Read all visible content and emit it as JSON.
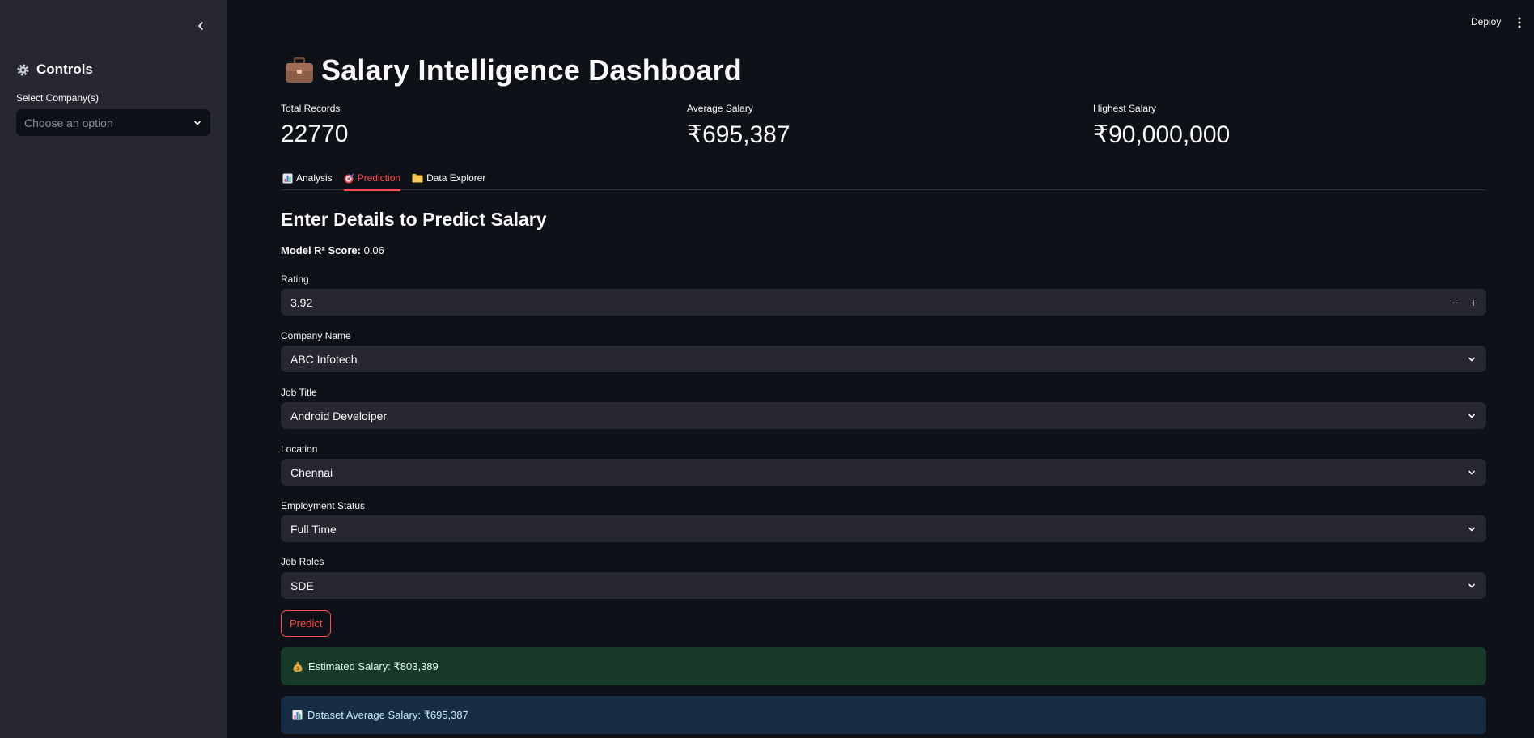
{
  "sidebar": {
    "title": "Controls",
    "title_icon": "gear-icon",
    "select_label": "Select Company(s)",
    "select_placeholder": "Choose an option"
  },
  "topbar": {
    "deploy_label": "Deploy"
  },
  "header": {
    "title": "Salary Intelligence Dashboard",
    "title_icon": "briefcase-icon"
  },
  "metrics": [
    {
      "label": "Total Records",
      "value": "22770"
    },
    {
      "label": "Average Salary",
      "value": "₹695,387"
    },
    {
      "label": "Highest Salary",
      "value": "₹90,000,000"
    }
  ],
  "tabs": [
    {
      "label": "Analysis",
      "icon": "bar-chart-icon",
      "active": false
    },
    {
      "label": "Prediction",
      "icon": "target-icon",
      "active": true
    },
    {
      "label": "Data Explorer",
      "icon": "folder-icon",
      "active": false
    }
  ],
  "prediction": {
    "section_title": "Enter Details to Predict Salary",
    "r2_label": "Model R² Score:",
    "r2_value": "0.06",
    "fields": [
      {
        "label": "Rating",
        "value": "3.92",
        "kind": "number"
      },
      {
        "label": "Company Name",
        "value": "ABC Infotech",
        "kind": "select"
      },
      {
        "label": "Job Title",
        "value": "Android Develoiper",
        "kind": "select"
      },
      {
        "label": "Location",
        "value": "Chennai",
        "kind": "select"
      },
      {
        "label": "Employment Status",
        "value": "Full Time",
        "kind": "select"
      },
      {
        "label": "Job Roles",
        "value": "SDE",
        "kind": "select"
      }
    ],
    "stepper_minus": "−",
    "stepper_plus": "+",
    "predict_label": "Predict",
    "result_success": "Estimated Salary: ₹803,389",
    "result_success_icon": "money-bag-icon",
    "result_info": "Dataset Average Salary: ₹695,387",
    "result_info_icon": "bar-chart-icon"
  },
  "colors": {
    "accent": "#ff4b4b",
    "background": "#0e1117",
    "sidebar": "#262730",
    "success_bg": "#173928",
    "info_bg": "#172d43"
  }
}
